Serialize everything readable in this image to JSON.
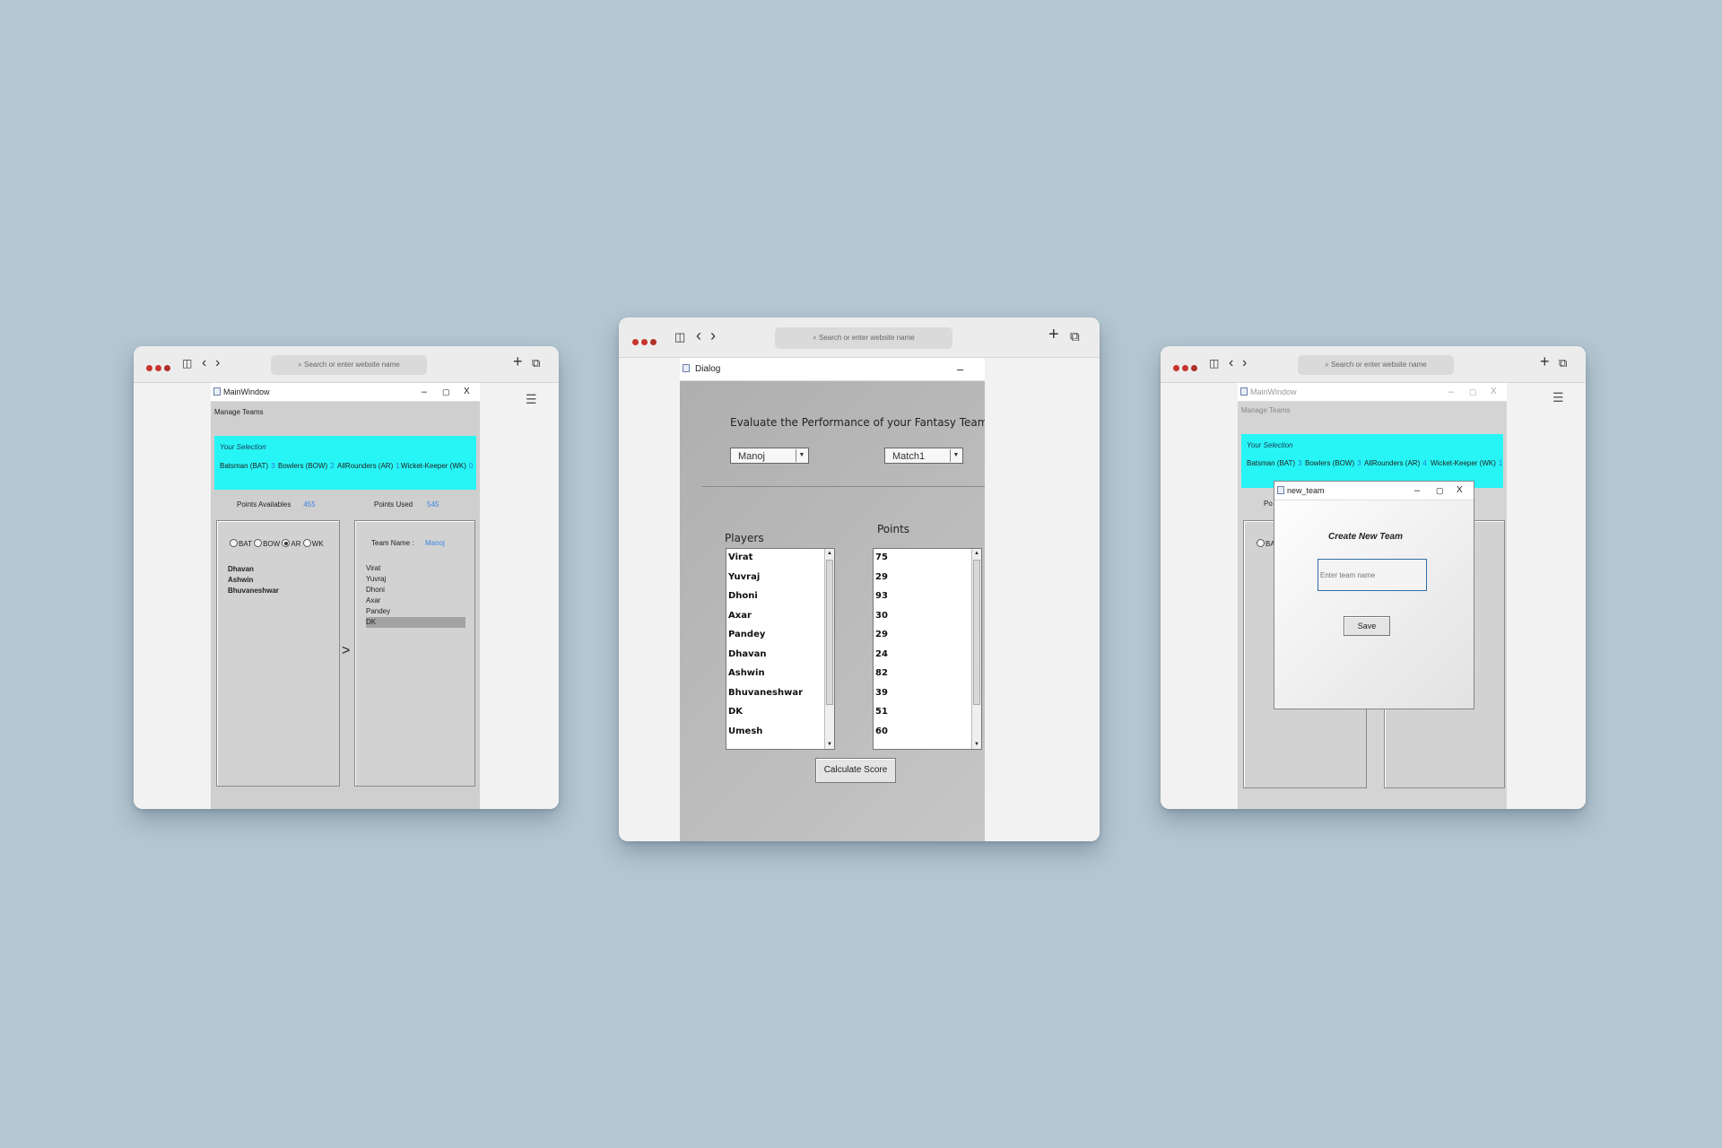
{
  "browser": {
    "url_placeholder": "Search or enter website name",
    "plus_label": "+",
    "back_label": "‹",
    "forward_label": "›"
  },
  "left_window": {
    "title": "MainWindow",
    "menu": "Manage Teams",
    "selection": {
      "header": "Your Selection",
      "items": [
        {
          "label": "Batsman (BAT)",
          "count": "3"
        },
        {
          "label": "Bowlers (BOW)",
          "count": "2"
        },
        {
          "label": "AllRounders (AR)",
          "count": "1"
        },
        {
          "label": "Wicket-Keeper (WK)",
          "count": "0"
        }
      ]
    },
    "points_available_label": "Points Availables",
    "points_available_value": "455",
    "points_used_label": "Points Used",
    "points_used_value": "545",
    "radios": [
      "BAT",
      "BOW",
      "AR",
      "WK"
    ],
    "radio_selected": "AR",
    "available_players": [
      "Dhavan",
      "Ashwin",
      "Bhuvaneshwar"
    ],
    "team_name_label": "Team Name :",
    "team_name_value": "Manoj",
    "team_players": [
      "Virat",
      "Yuvraj",
      "Dhoni",
      "Axar",
      "Pandey",
      "DK"
    ],
    "team_selected": "DK",
    "move_arrow": ">"
  },
  "center_window": {
    "title": "Dialog",
    "heading": "Evaluate the Performance of your Fantasy Team",
    "team_combo": "Manoj",
    "match_combo": "Match1",
    "players_label": "Players",
    "points_label": "Points",
    "players": [
      "Virat",
      "Yuvraj",
      "Dhoni",
      "Axar",
      "Pandey",
      "Dhavan",
      "Ashwin",
      "Bhuvaneshwar",
      "DK",
      "Umesh"
    ],
    "points": [
      "75",
      "29",
      "93",
      "30",
      "29",
      "24",
      "82",
      "39",
      "51",
      "60"
    ],
    "calculate_button": "Calculate Score"
  },
  "right_window": {
    "title": "MainWindow",
    "menu": "Manage Teams",
    "selection": {
      "header": "Your Selection",
      "items": [
        {
          "label": "Batsman (BAT)",
          "count": "3"
        },
        {
          "label": "Bowlers (BOW)",
          "count": "3"
        },
        {
          "label": "AllRounders (AR)",
          "count": "4"
        },
        {
          "label": "Wicket-Keeper (WK)",
          "count": "1"
        }
      ]
    },
    "partial_points_label": "Po",
    "partial_radio_label": "BA",
    "new_team_dialog": {
      "title": "new_team",
      "heading": "Create New Team",
      "input_placeholder": "Enter team name",
      "save_button": "Save"
    }
  }
}
